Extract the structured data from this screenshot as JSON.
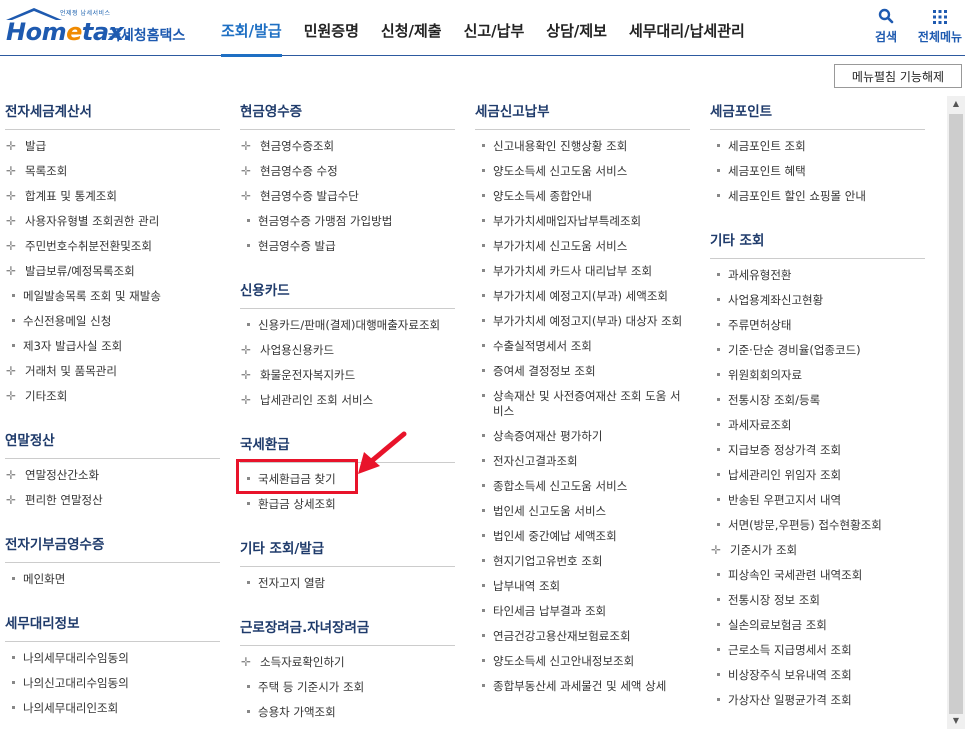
{
  "header": {
    "logo_sub": "언제쩡 납세서비스",
    "logo_main_a": "Hom",
    "logo_main_e": "e",
    "logo_main_b": "tax.",
    "logo_kr": "국세청홈택스",
    "nav": [
      {
        "label": "조회/발급"
      },
      {
        "label": "민원증명"
      },
      {
        "label": "신청/제출"
      },
      {
        "label": "신고/납부"
      },
      {
        "label": "상담/제보"
      },
      {
        "label": "세무대리/납세관리"
      }
    ],
    "search_label": "검색",
    "allmenu_label": "전체메뉴"
  },
  "toggle_label": "메뉴펼침 기능해제",
  "colors": {
    "accent": "#1e6fc3",
    "highlight": "#e8132a"
  },
  "columns": [
    [
      {
        "title": "전자세금계산서",
        "items": [
          {
            "label": "발급",
            "mark": "plus"
          },
          {
            "label": "목록조회",
            "mark": "plus"
          },
          {
            "label": "합계표 및 통계조회",
            "mark": "plus"
          },
          {
            "label": "사용자유형별 조회권한 관리",
            "mark": "plus"
          },
          {
            "label": "주민번호수취분전환및조회",
            "mark": "plus"
          },
          {
            "label": "발급보류/예정목록조회",
            "mark": "plus"
          },
          {
            "label": "메일발송목록 조회 및 재발송",
            "mark": "dot"
          },
          {
            "label": "수신전용메일 신청",
            "mark": "dot"
          },
          {
            "label": "제3자 발급사실 조회",
            "mark": "dot"
          },
          {
            "label": "거래처 및 품목관리",
            "mark": "plus"
          },
          {
            "label": "기타조회",
            "mark": "plus"
          }
        ]
      },
      {
        "title": "연말정산",
        "items": [
          {
            "label": "연말정산간소화",
            "mark": "plus"
          },
          {
            "label": "편리한 연말정산",
            "mark": "plus"
          }
        ]
      },
      {
        "title": "전자기부금영수증",
        "items": [
          {
            "label": "메인화면",
            "mark": "dot"
          }
        ]
      },
      {
        "title": "세무대리정보",
        "items": [
          {
            "label": "나의세무대리수임동의",
            "mark": "dot"
          },
          {
            "label": "나의신고대리수임동의",
            "mark": "dot"
          },
          {
            "label": "나의세무대리인조회",
            "mark": "dot"
          }
        ]
      }
    ],
    [
      {
        "title": "현금영수증",
        "items": [
          {
            "label": "현금영수증조회",
            "mark": "plus"
          },
          {
            "label": "현금영수증 수정",
            "mark": "plus"
          },
          {
            "label": "현금영수증 발급수단",
            "mark": "plus"
          },
          {
            "label": "현금영수증 가맹점 가입방법",
            "mark": "dot"
          },
          {
            "label": "현금영수증 발급",
            "mark": "dot"
          }
        ]
      },
      {
        "title": "신용카드",
        "items": [
          {
            "label": "신용카드/판매(결제)대행매출자료조회",
            "mark": "dot"
          },
          {
            "label": "사업용신용카드",
            "mark": "plus"
          },
          {
            "label": "화물운전자복지카드",
            "mark": "plus"
          },
          {
            "label": "납세관리인 조회 서비스",
            "mark": "plus"
          }
        ]
      },
      {
        "title": "국세환급",
        "items": [
          {
            "label": "국세환급금 찾기",
            "mark": "dot"
          },
          {
            "label": "환급금 상세조회",
            "mark": "dot"
          }
        ]
      },
      {
        "title": "기타 조회/발급",
        "items": [
          {
            "label": "전자고지 열람",
            "mark": "dot"
          }
        ]
      },
      {
        "title": "근로장려금.자녀장려금",
        "items": [
          {
            "label": "소득자료확인하기",
            "mark": "plus"
          },
          {
            "label": "주택 등 기준시가 조회",
            "mark": "dot"
          },
          {
            "label": "승용차 가액조회",
            "mark": "dot"
          }
        ]
      }
    ],
    [
      {
        "title": "세금신고납부",
        "items": [
          {
            "label": "신고내용확인 진행상황 조회",
            "mark": "dot"
          },
          {
            "label": "양도소득세 신고도움 서비스",
            "mark": "dot"
          },
          {
            "label": "양도소득세 종합안내",
            "mark": "dot"
          },
          {
            "label": "부가가치세매입자납부특례조회",
            "mark": "dot"
          },
          {
            "label": "부가가치세 신고도움 서비스",
            "mark": "dot"
          },
          {
            "label": "부가가치세 카드사 대리납부 조회",
            "mark": "dot"
          },
          {
            "label": "부가가치세 예정고지(부과) 세액조회",
            "mark": "dot"
          },
          {
            "label": "부가가치세 예정고지(부과) 대상자 조회",
            "mark": "dot"
          },
          {
            "label": "수출실적명세서 조회",
            "mark": "dot"
          },
          {
            "label": "증여세 결정정보 조회",
            "mark": "dot"
          },
          {
            "label": "상속재산 및 사전증여재산 조회 도움 서비스",
            "mark": "dot"
          },
          {
            "label": "상속증여재산 평가하기",
            "mark": "dot"
          },
          {
            "label": "전자신고결과조회",
            "mark": "dot"
          },
          {
            "label": "종합소득세 신고도움 서비스",
            "mark": "dot"
          },
          {
            "label": "법인세 신고도움 서비스",
            "mark": "dot"
          },
          {
            "label": "법인세 중간예납 세액조회",
            "mark": "dot"
          },
          {
            "label": "현지기업고유번호 조회",
            "mark": "dot"
          },
          {
            "label": "납부내역 조회",
            "mark": "dot"
          },
          {
            "label": "타인세금 납부결과 조회",
            "mark": "dot"
          },
          {
            "label": "연금건강고용산재보험료조회",
            "mark": "dot"
          },
          {
            "label": "양도소득세 신고안내정보조회",
            "mark": "dot"
          },
          {
            "label": "종합부동산세 과세물건 및 세액 상세",
            "mark": "dot"
          }
        ]
      }
    ],
    [
      {
        "title": "세금포인트",
        "items": [
          {
            "label": "세금포인트 조회",
            "mark": "dot"
          },
          {
            "label": "세금포인트 혜택",
            "mark": "dot"
          },
          {
            "label": "세금포인트 할인 쇼핑몰 안내",
            "mark": "dot"
          }
        ]
      },
      {
        "title": "기타 조회",
        "items": [
          {
            "label": "과세유형전환",
            "mark": "dot"
          },
          {
            "label": "사업용계좌신고현황",
            "mark": "dot"
          },
          {
            "label": "주류면허상태",
            "mark": "dot"
          },
          {
            "label": "기준·단순 경비율(업종코드)",
            "mark": "dot"
          },
          {
            "label": "위원회회의자료",
            "mark": "dot"
          },
          {
            "label": "전통시장 조회/등록",
            "mark": "dot"
          },
          {
            "label": "과세자료조회",
            "mark": "dot"
          },
          {
            "label": "지급보증 정상가격 조회",
            "mark": "dot"
          },
          {
            "label": "납세관리인 위임자 조회",
            "mark": "dot"
          },
          {
            "label": "반송된 우편고지서 내역",
            "mark": "dot"
          },
          {
            "label": "서면(방문,우편등) 접수현황조회",
            "mark": "dot"
          },
          {
            "label": "기준시가 조회",
            "mark": "plus"
          },
          {
            "label": "피상속인 국세관련 내역조회",
            "mark": "dot"
          },
          {
            "label": "전통시장 정보 조회",
            "mark": "dot"
          },
          {
            "label": "실손의료보험금 조회",
            "mark": "dot"
          },
          {
            "label": "근로소득 지급명세서 조회",
            "mark": "dot"
          },
          {
            "label": "비상장주식 보유내역 조회",
            "mark": "dot"
          },
          {
            "label": "가상자산 일평균가격 조회",
            "mark": "dot"
          }
        ]
      }
    ]
  ]
}
